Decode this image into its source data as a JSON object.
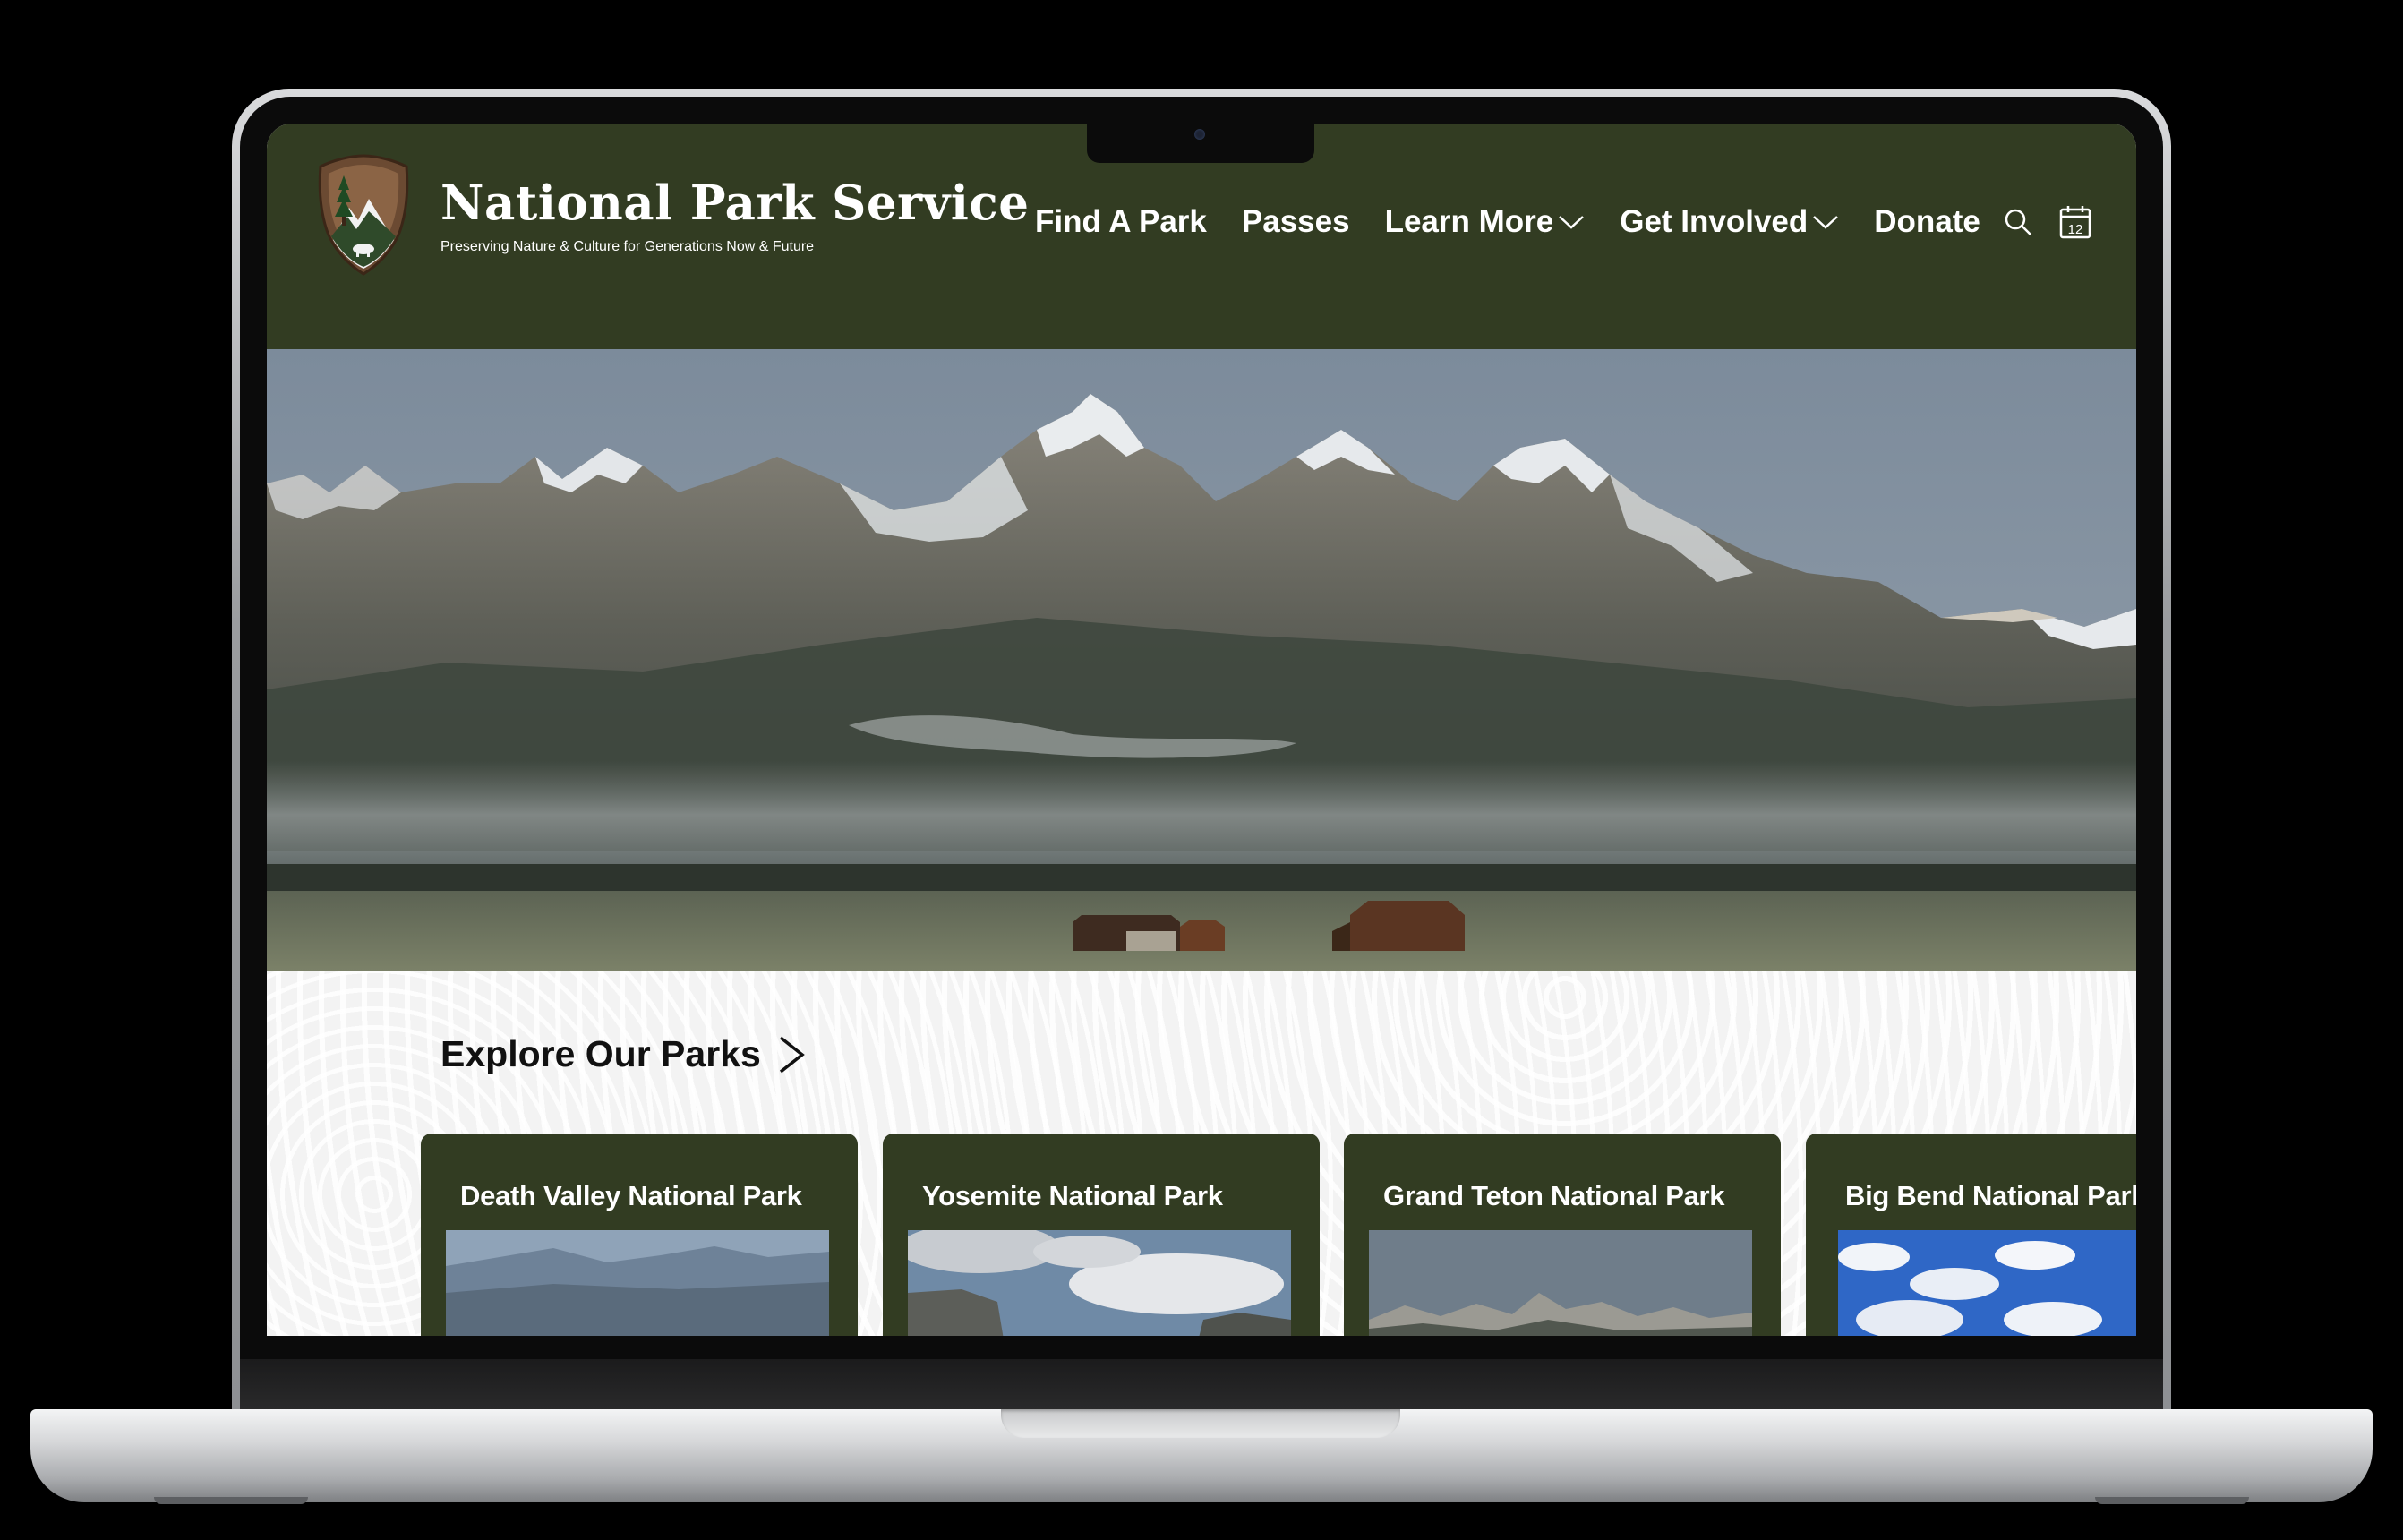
{
  "site": {
    "title": "National Park Service",
    "tagline": "Preserving Nature & Culture for Generations Now & Future",
    "logo_text": "NATIONAL PARK SERVICE"
  },
  "nav": {
    "items": [
      {
        "label": "Find A Park",
        "has_dropdown": false
      },
      {
        "label": "Passes",
        "has_dropdown": false
      },
      {
        "label": "Learn More",
        "has_dropdown": true
      },
      {
        "label": "Get Involved",
        "has_dropdown": true
      },
      {
        "label": "Donate",
        "has_dropdown": false
      }
    ],
    "icons": [
      "search-icon",
      "calendar-icon"
    ],
    "calendar_day": "12"
  },
  "explore": {
    "heading": "Explore Our Parks",
    "parks": [
      {
        "name": "Death Valley National Park"
      },
      {
        "name": "Yosemite National Park"
      },
      {
        "name": "Grand Teton National Park"
      },
      {
        "name": "Big Bend National Park"
      }
    ]
  },
  "colors": {
    "header_bg": "#323c22",
    "card_bg": "#323c22",
    "text_light": "#ffffff",
    "section_bg": "#f3f3f3"
  }
}
